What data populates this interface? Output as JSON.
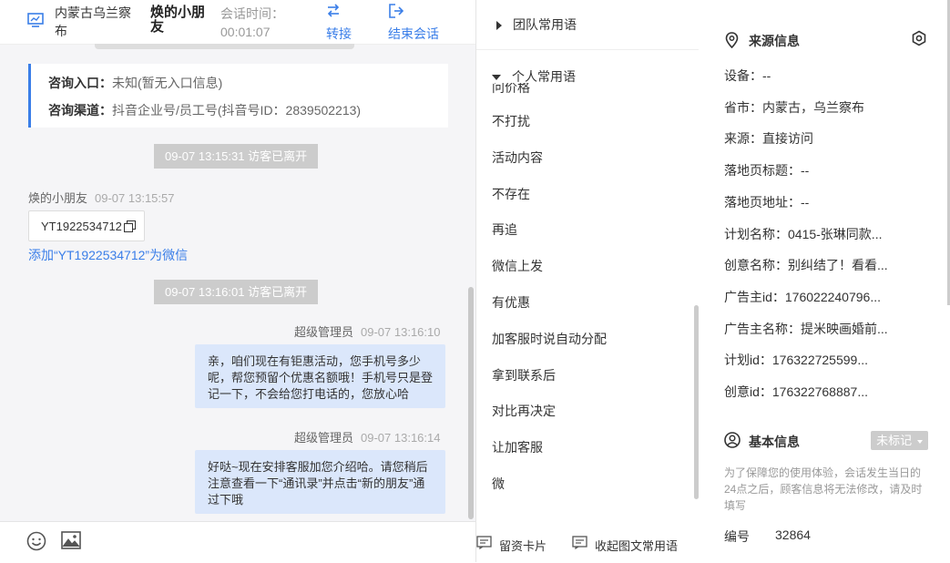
{
  "header": {
    "region": "内蒙古乌兰察布",
    "visitor_name": "焕的小朋友",
    "session_time_label": "会话时间：",
    "session_time": "00:01:07",
    "transfer_label": "转接",
    "end_label": "结束会话"
  },
  "info_card": {
    "entry_label": "咨询入口：",
    "entry_value": "未知(暂无入口信息)",
    "channel_label": "咨询渠道：",
    "channel_value": "抖音企业号/员工号(抖音号ID：2839502213)"
  },
  "messages": {
    "sys1": "09-07 13:15:31 访客已离开",
    "visitor_name": "焕的小朋友",
    "visitor_time": "09-07 13:15:57",
    "visitor_text": "YT1922534712",
    "add_wechat": "添加“YT1922534712”为微信",
    "sys2": "09-07 13:16:01 访客已离开",
    "agent1_name": "超级管理员",
    "agent1_time": "09-07 13:16:10",
    "agent1_text": "亲，咱们现在有钜惠活动，您手机号多少呢，帮您预留个优惠名额哦！手机号只是登记一下，不会给您打电话的，您放心哈",
    "agent2_name": "超级管理员",
    "agent2_time": "09-07 13:16:14",
    "agent2_text": "好哒~现在安排客服加您介绍哈。请您稍后注意查看一下“通讯录”并点击“新的朋友”通过下哦"
  },
  "phrases": {
    "team_group": "团队常用语",
    "personal_group": "个人常用语",
    "partial_item": "问价格",
    "items": [
      "不打扰",
      "活动内容",
      "不存在",
      "再追",
      "微信上发",
      "有优惠",
      "加客服时说自动分配",
      "拿到联系后",
      "对比再决定",
      "让加客服",
      "微"
    ],
    "footer_card": "留资卡片",
    "footer_collapse": "收起图文常用语"
  },
  "source_info": {
    "title": "来源信息",
    "fields": [
      "设备：--",
      "省市：内蒙古，乌兰察布",
      "来源：直接访问",
      "落地页标题：--",
      "落地页地址：--",
      "计划名称：0415-张琳同款...",
      "创意名称：别纠结了！看看...",
      "广告主id：176022240796...",
      "广告主名称：提米映画婚前...",
      "计划id：176322725599...",
      "创意id：176322768887..."
    ]
  },
  "basic_info": {
    "title": "基本信息",
    "tag_label": "未标记",
    "notice": "为了保障您的使用体验，会话发生当日的24点之后，顾客信息将无法修改，请及时填写",
    "number_label": "编号",
    "number_value": "32864"
  },
  "colors": {
    "accent": "#3a7ee8",
    "agent_bubble": "#dbe7fb",
    "system_pill": "#cccccc"
  }
}
